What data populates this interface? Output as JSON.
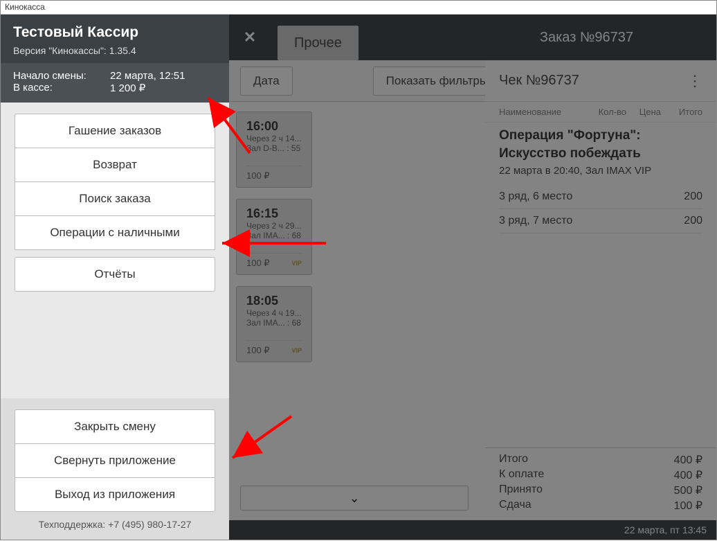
{
  "window": {
    "title": "Кинокасса"
  },
  "side_panel": {
    "user_name": "Тестовый Кассир",
    "version_label": "Версия \"Кинокассы\": 1.35.4",
    "shift_start_label": "Начало смены:",
    "shift_start_value": "22 марта, 12:51",
    "cash_label": "В кассе:",
    "cash_value": "1 200 ₽",
    "menu": {
      "cancel_orders": "Гашение заказов",
      "refund": "Возврат",
      "find_order": "Поиск заказа",
      "cash_ops": "Операции с наличными",
      "reports": "Отчёты"
    },
    "bottom": {
      "close_shift": "Закрыть смену",
      "minimize": "Свернуть приложение",
      "exit": "Выход из приложения"
    },
    "support": "Техподдержка: +7 (495) 980-17-27"
  },
  "header": {
    "tab_other": "Прочее",
    "order_no": "Заказ №96737"
  },
  "filters": {
    "date": "Дата",
    "show": "Показать фильтры"
  },
  "check": {
    "title": "Чек №96737",
    "cols": {
      "name": "Наименование",
      "qty": "Кол-во",
      "price": "Цена",
      "total": "Итого"
    },
    "film_title": "Операция \"Фортуна\": Искусство побеждать",
    "film_sub": "22 марта в 20:40, Зал IMAX VIP",
    "seats": [
      {
        "label": "3 ряд, 6 место",
        "price": "200"
      },
      {
        "label": "3 ряд, 7 место",
        "price": "200"
      }
    ],
    "totals": {
      "itogo_l": "Итого",
      "itogo_v": "400 ₽",
      "pay_l": "К оплате",
      "pay_v": "400 ₽",
      "recv_l": "Принято",
      "recv_v": "500 ₽",
      "change_l": "Сдача",
      "change_v": "100 ₽"
    }
  },
  "sessions": [
    {
      "time": "16:00",
      "line1": "Через 2 ч 14...",
      "line2": "Зал D-B... : 55",
      "price": "100 ₽",
      "vip": ""
    },
    {
      "time": "16:15",
      "line1": "Через 2 ч 29...",
      "line2": "Зал IMA... : 68",
      "price": "100 ₽",
      "vip": "VIP"
    },
    {
      "time": "18:05",
      "line1": "Через 4 ч 19...",
      "line2": "Зал IMA... : 68",
      "price": "100 ₽",
      "vip": "VIP"
    }
  ],
  "status_bar": {
    "datetime": "22 марта, пт  13:45"
  }
}
